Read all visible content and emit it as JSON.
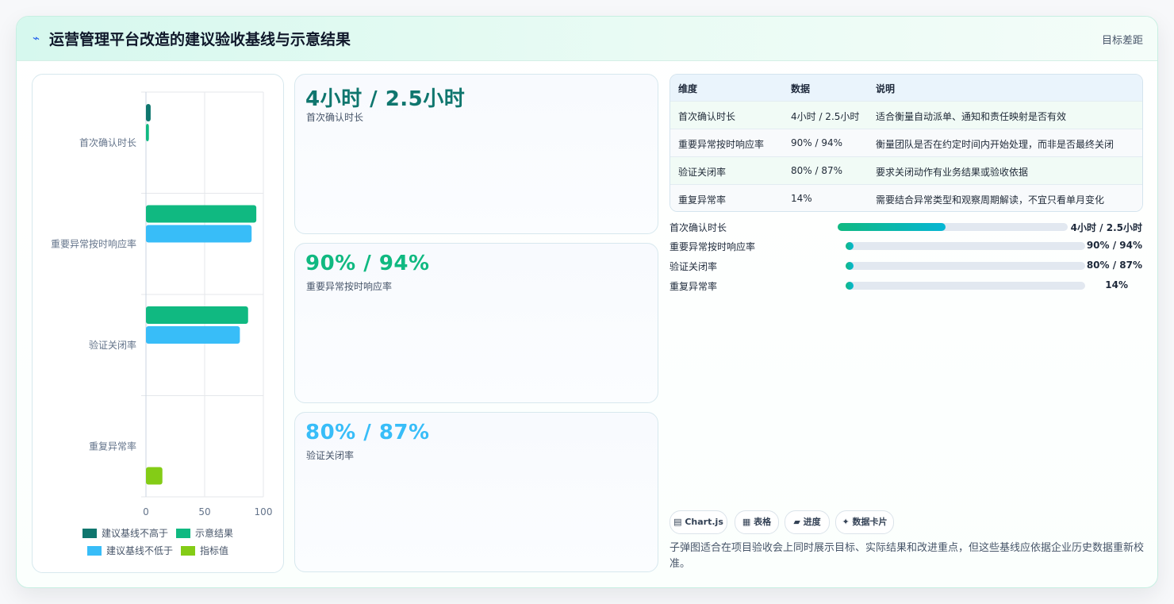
{
  "header": {
    "title": "运营管理平台改造的建议验收基线与示意结果",
    "link": "目标差距"
  },
  "chart_data": {
    "type": "bar",
    "orientation": "horizontal",
    "categories": [
      "首次确认时长",
      "重要异常按时响应率",
      "验证关闭率",
      "重复异常率"
    ],
    "series": [
      {
        "name": "建议基线不高于",
        "color": "#0f766e",
        "values": [
          4,
          null,
          null,
          null
        ]
      },
      {
        "name": "示意结果",
        "color": "#10b981",
        "values": [
          2.5,
          94,
          87,
          null
        ]
      },
      {
        "name": "建议基线不低于",
        "color": "#38bdf8",
        "values": [
          null,
          90,
          80,
          null
        ]
      },
      {
        "name": "指标值",
        "color": "#84cc16",
        "values": [
          null,
          null,
          null,
          14
        ]
      }
    ],
    "xlim": [
      0,
      100
    ],
    "xticks": [
      "0",
      "50",
      "100"
    ],
    "grid": true,
    "legend_position": "bottom"
  },
  "kpis": [
    {
      "value": "4小时 / 2.5小时",
      "label": "首次确认时长",
      "color": "#0f766e"
    },
    {
      "value": "90% / 94%",
      "label": "重要异常按时响应率",
      "color": "#10b981"
    },
    {
      "value": "80% / 87%",
      "label": "验证关闭率",
      "color": "#38bdf8"
    }
  ],
  "table": {
    "headers": [
      "维度",
      "数据",
      "说明"
    ],
    "rows": [
      [
        "首次确认时长",
        "4小时 / 2.5小时",
        "适合衡量自动派单、通知和责任映射是否有效"
      ],
      [
        "重要异常按时响应率",
        "90% / 94%",
        "衡量团队是否在约定时间内开始处理，而非是否最终关闭"
      ],
      [
        "验证关闭率",
        "80% / 87%",
        "要求关闭动作有业务结果或验收依据"
      ],
      [
        "重复异常率",
        "14%",
        "需要结合异常类型和观察周期解读，不宜只看单月变化"
      ]
    ]
  },
  "progress": [
    {
      "label": "首次确认时长",
      "value_text": "4小时 / 2.5小时",
      "fraction": 0.47
    },
    {
      "label": "重要异常按时响应率",
      "value_text": "90% / 94%",
      "fraction": 0.03
    },
    {
      "label": "验证关闭率",
      "value_text": "80% / 87%",
      "fraction": 0.03
    },
    {
      "label": "重复异常率",
      "value_text": "14%",
      "fraction": 0.03
    }
  ],
  "chips": [
    {
      "icon": "chart-icon",
      "glyph": "▤",
      "label": "Chart.js"
    },
    {
      "icon": "table-icon",
      "glyph": "▦",
      "label": "表格"
    },
    {
      "icon": "progress-icon",
      "glyph": "▰",
      "label": "进度"
    },
    {
      "icon": "sparkle-icon",
      "glyph": "✦",
      "label": "数据卡片"
    }
  ],
  "note": "子弹图适合在项目验收会上同时展示目标、实际结果和改进重点，但这些基线应依据企业历史数据重新校准。"
}
